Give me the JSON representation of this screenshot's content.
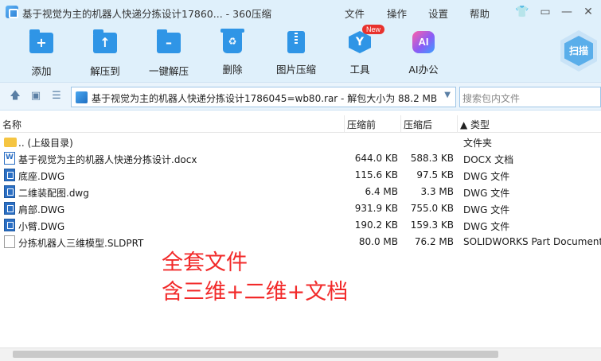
{
  "window": {
    "title": "基于视觉为主的机器人快递分拣设计17860... - 360压缩",
    "menu": [
      "文件",
      "操作",
      "设置",
      "帮助"
    ]
  },
  "toolbar": {
    "items": [
      {
        "label": "添加",
        "icon": "add-folder-icon"
      },
      {
        "label": "解压到",
        "icon": "extract-to-icon"
      },
      {
        "label": "一键解压",
        "icon": "one-click-extract-icon"
      },
      {
        "label": "删除",
        "icon": "delete-icon"
      },
      {
        "label": "图片压缩",
        "icon": "image-compress-icon"
      },
      {
        "label": "工具",
        "icon": "tools-icon",
        "badge": "New"
      },
      {
        "label": "AI办公",
        "icon": "ai-office-icon",
        "glyph": "AI"
      }
    ],
    "scan_label": "扫描"
  },
  "address": {
    "path": "基于视觉为主的机器人快递分拣设计1786045=wb80.rar - 解包大小为 88.2 MB",
    "search_placeholder": "搜索包内文件"
  },
  "list": {
    "columns": {
      "name": "名称",
      "packed": "压缩前",
      "size": "压缩后",
      "type": "类型"
    },
    "rows": [
      {
        "name": ".. (上级目录)",
        "packed": "",
        "size": "",
        "type": "文件夹",
        "icon": "folder-icon"
      },
      {
        "name": "基于视觉为主的机器人快递分拣设计.docx",
        "packed": "644.0 KB",
        "size": "588.3 KB",
        "type": "DOCX 文档",
        "icon": "docx-icon"
      },
      {
        "name": "底座.DWG",
        "packed": "115.6 KB",
        "size": "97.5 KB",
        "type": "DWG 文件",
        "icon": "dwg-icon"
      },
      {
        "name": "二维装配图.dwg",
        "packed": "6.4 MB",
        "size": "3.3 MB",
        "type": "DWG 文件",
        "icon": "dwg-icon"
      },
      {
        "name": "肩部.DWG",
        "packed": "931.9 KB",
        "size": "755.0 KB",
        "type": "DWG 文件",
        "icon": "dwg-icon"
      },
      {
        "name": "小臂.DWG",
        "packed": "190.2 KB",
        "size": "159.3 KB",
        "type": "DWG 文件",
        "icon": "dwg-icon"
      },
      {
        "name": "分拣机器人三维模型.SLDPRT",
        "packed": "80.0 MB",
        "size": "76.2 MB",
        "type": "SOLIDWORKS Part Document",
        "icon": "sldprt-icon"
      }
    ]
  },
  "overlay": {
    "line1": "全套文件",
    "line2": "含三维+二维+文档",
    "color": "#f22a2a"
  }
}
